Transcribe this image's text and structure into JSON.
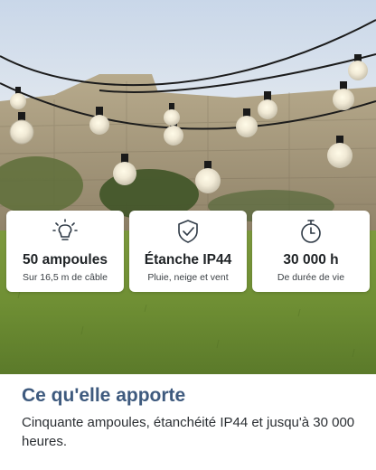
{
  "features": [
    {
      "icon": "bulb-icon",
      "title": "50 ampoules",
      "subtitle": "Sur 16,5 m de câble"
    },
    {
      "icon": "shield-check-icon",
      "title": "Étanche IP44",
      "subtitle": "Pluie, neige et vent"
    },
    {
      "icon": "timer-icon",
      "title": "30 000 h",
      "subtitle": "De durée de vie"
    }
  ],
  "caption": {
    "heading": "Ce qu'elle apporte",
    "text": "Cinquante ampoules, étanchéité IP44 et jusqu'à 30 000 heures."
  },
  "colors": {
    "heading": "#3e5a7e",
    "icon": "#2f3a46",
    "lawn": "#6f8f34",
    "wall": "#a99a7c"
  }
}
